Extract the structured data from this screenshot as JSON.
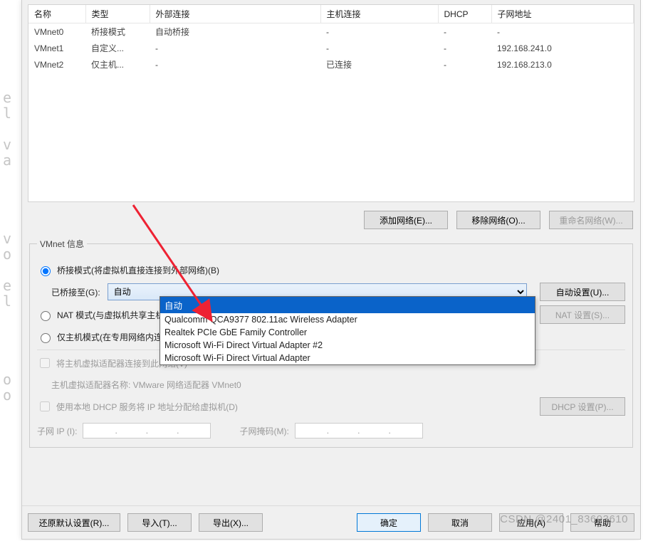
{
  "bg_glyphs": "\n\n\ne\nl\n\nv\na\n\n\n\n\nv\no\n\ne\nl\n\n\n\n\no\no\n",
  "table": {
    "headers": [
      "名称",
      "类型",
      "外部连接",
      "主机连接",
      "DHCP",
      "子网地址"
    ],
    "rows": [
      {
        "name": "VMnet0",
        "type": "桥接模式",
        "ext": "自动桥接",
        "host": "-",
        "dhcp": "-",
        "subnet": "-"
      },
      {
        "name": "VMnet1",
        "type": "自定义...",
        "ext": "-",
        "host": "-",
        "dhcp": "-",
        "subnet": "192.168.241.0"
      },
      {
        "name": "VMnet2",
        "type": "仅主机...",
        "ext": "-",
        "host": "已连接",
        "dhcp": "-",
        "subnet": "192.168.213.0"
      }
    ]
  },
  "buttons": {
    "add_network": "添加网络(E)...",
    "remove_network": "移除网络(O)...",
    "rename_network": "重命名网络(W)..."
  },
  "group": {
    "legend": "VMnet 信息",
    "bridged_label": "桥接模式(将虚拟机直接连接到外部网络)(B)",
    "bridged_to_label": "已桥接至(G):",
    "bridged_selected": "自动",
    "auto_settings": "自动设置(U)...",
    "nat_label": "NAT 模式(与虚拟机共享主机的 IP 地址)(N)",
    "nat_settings": "NAT 设置(S)...",
    "hostonly_label": "仅主机模式(在专用网络内连接虚拟机)(H)",
    "connect_host_adapter_label": "将主机虚拟适配器连接到此网络(V)",
    "host_adapter_name_label": "主机虚拟适配器名称: VMware 网络适配器 VMnet0",
    "use_dhcp_label": "使用本地 DHCP 服务将 IP 地址分配给虚拟机(D)",
    "dhcp_settings": "DHCP 设置(P)...",
    "subnet_ip_label": "子网 IP (I):",
    "subnet_mask_label": "子网掩码(M):"
  },
  "dropdown_options": [
    "自动",
    "Qualcomm QCA9377 802.11ac Wireless Adapter",
    "Realtek PCIe GbE Family Controller",
    "Microsoft Wi-Fi Direct Virtual Adapter #2",
    "Microsoft Wi-Fi Direct Virtual Adapter"
  ],
  "bottom": {
    "restore_defaults": "还原默认设置(R)...",
    "import": "导入(T)...",
    "export": "导出(X)...",
    "ok": "确定",
    "cancel": "取消",
    "apply": "应用(A)",
    "help": "帮助"
  },
  "watermark": "CSDN @2401_83693610"
}
